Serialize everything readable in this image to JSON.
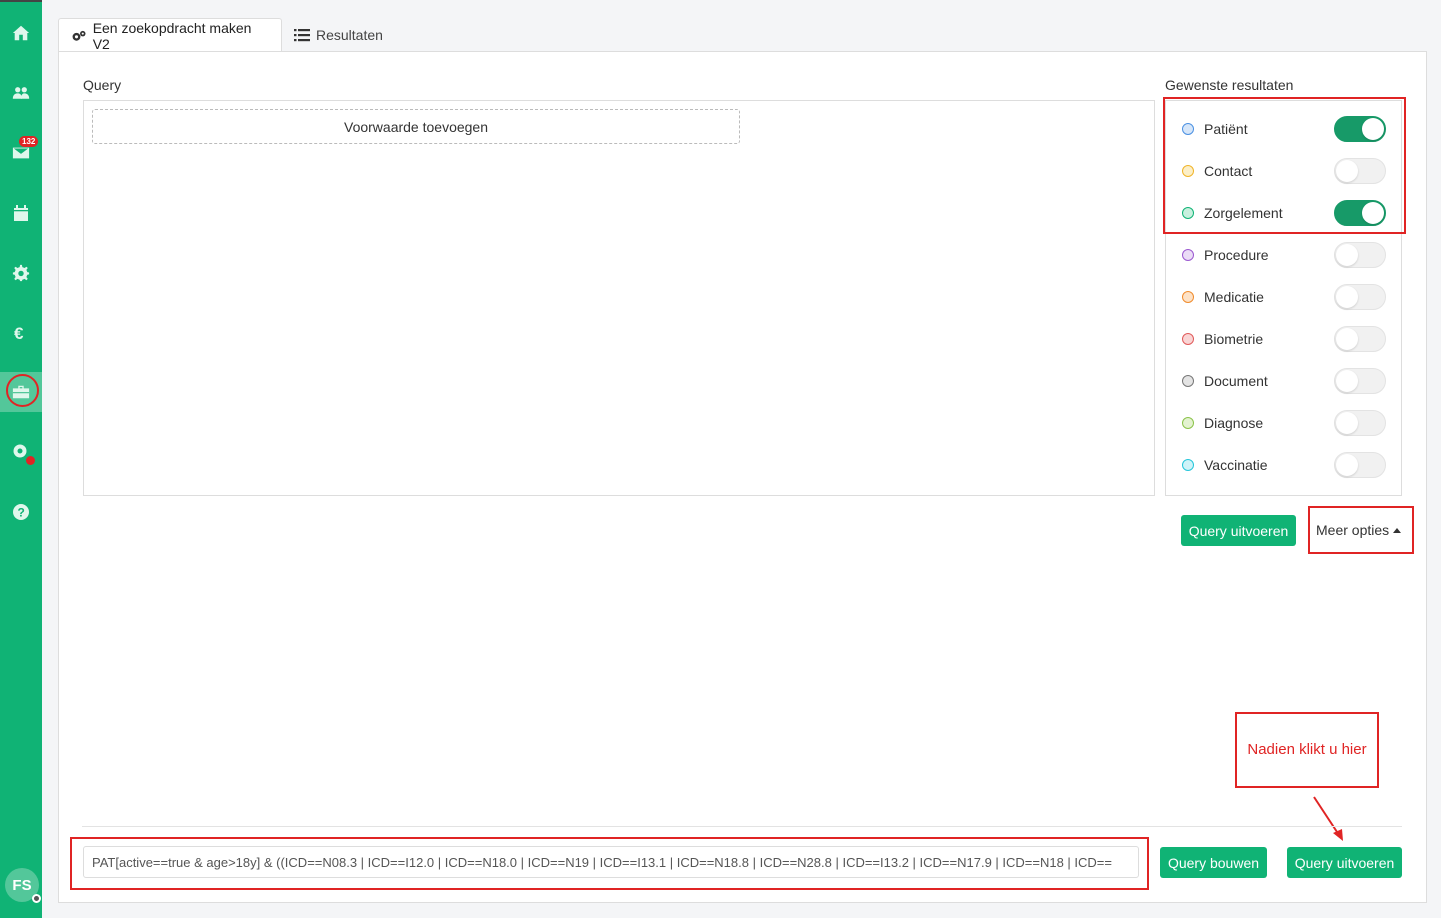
{
  "sidebar": {
    "items": [
      {
        "icon": "home-icon"
      },
      {
        "icon": "users-icon"
      },
      {
        "icon": "mail-icon",
        "badge": "132"
      },
      {
        "icon": "calendar-icon"
      },
      {
        "icon": "gear-icon"
      },
      {
        "icon": "euro-icon"
      },
      {
        "icon": "briefcase-icon",
        "active": true
      },
      {
        "icon": "rocket-icon"
      },
      {
        "icon": "help-icon"
      }
    ],
    "avatar_initials": "FS"
  },
  "tabs": [
    {
      "label": "Een zoekopdracht maken V2",
      "icon": "gears-icon",
      "active": true
    },
    {
      "label": "Resultaten",
      "icon": "list-icon",
      "active": false
    }
  ],
  "query": {
    "label": "Query",
    "add_condition_label": "Voorwaarde toevoegen"
  },
  "results": {
    "label": "Gewenste resultaten",
    "items": [
      {
        "name": "Patiënt",
        "color": "#4a90e2",
        "on": true
      },
      {
        "name": "Contact",
        "color": "#f0b429",
        "on": false
      },
      {
        "name": "Zorgelement",
        "color": "#10b375",
        "on": true
      },
      {
        "name": "Procedure",
        "color": "#9b59d0",
        "on": false
      },
      {
        "name": "Medicatie",
        "color": "#f08c2e",
        "on": false
      },
      {
        "name": "Biometrie",
        "color": "#e05a5a",
        "on": false
      },
      {
        "name": "Document",
        "color": "#777777",
        "on": false
      },
      {
        "name": "Diagnose",
        "color": "#8bc34a",
        "on": false
      },
      {
        "name": "Vaccinatie",
        "color": "#26c6da",
        "on": false
      }
    ]
  },
  "actions": {
    "run_query_label": "Query uitvoeren",
    "more_options_label": "Meer opties",
    "build_query_label": "Query bouwen",
    "run_query_bottom_label": "Query uitvoeren"
  },
  "query_string": "PAT[active==true & age>18y] & ((ICD==N08.3 | ICD==I12.0 | ICD==N18.0 | ICD==N19 | ICD==I13.1 | ICD==N18.8 | ICD==N28.8 | ICD==I13.2 | ICD==N17.9 | ICD==N18 | ICD==",
  "annotation": {
    "note_text": "Nadien klikt u hier"
  },
  "colors": {
    "brand": "#10b375",
    "annotation": "#e02424"
  }
}
